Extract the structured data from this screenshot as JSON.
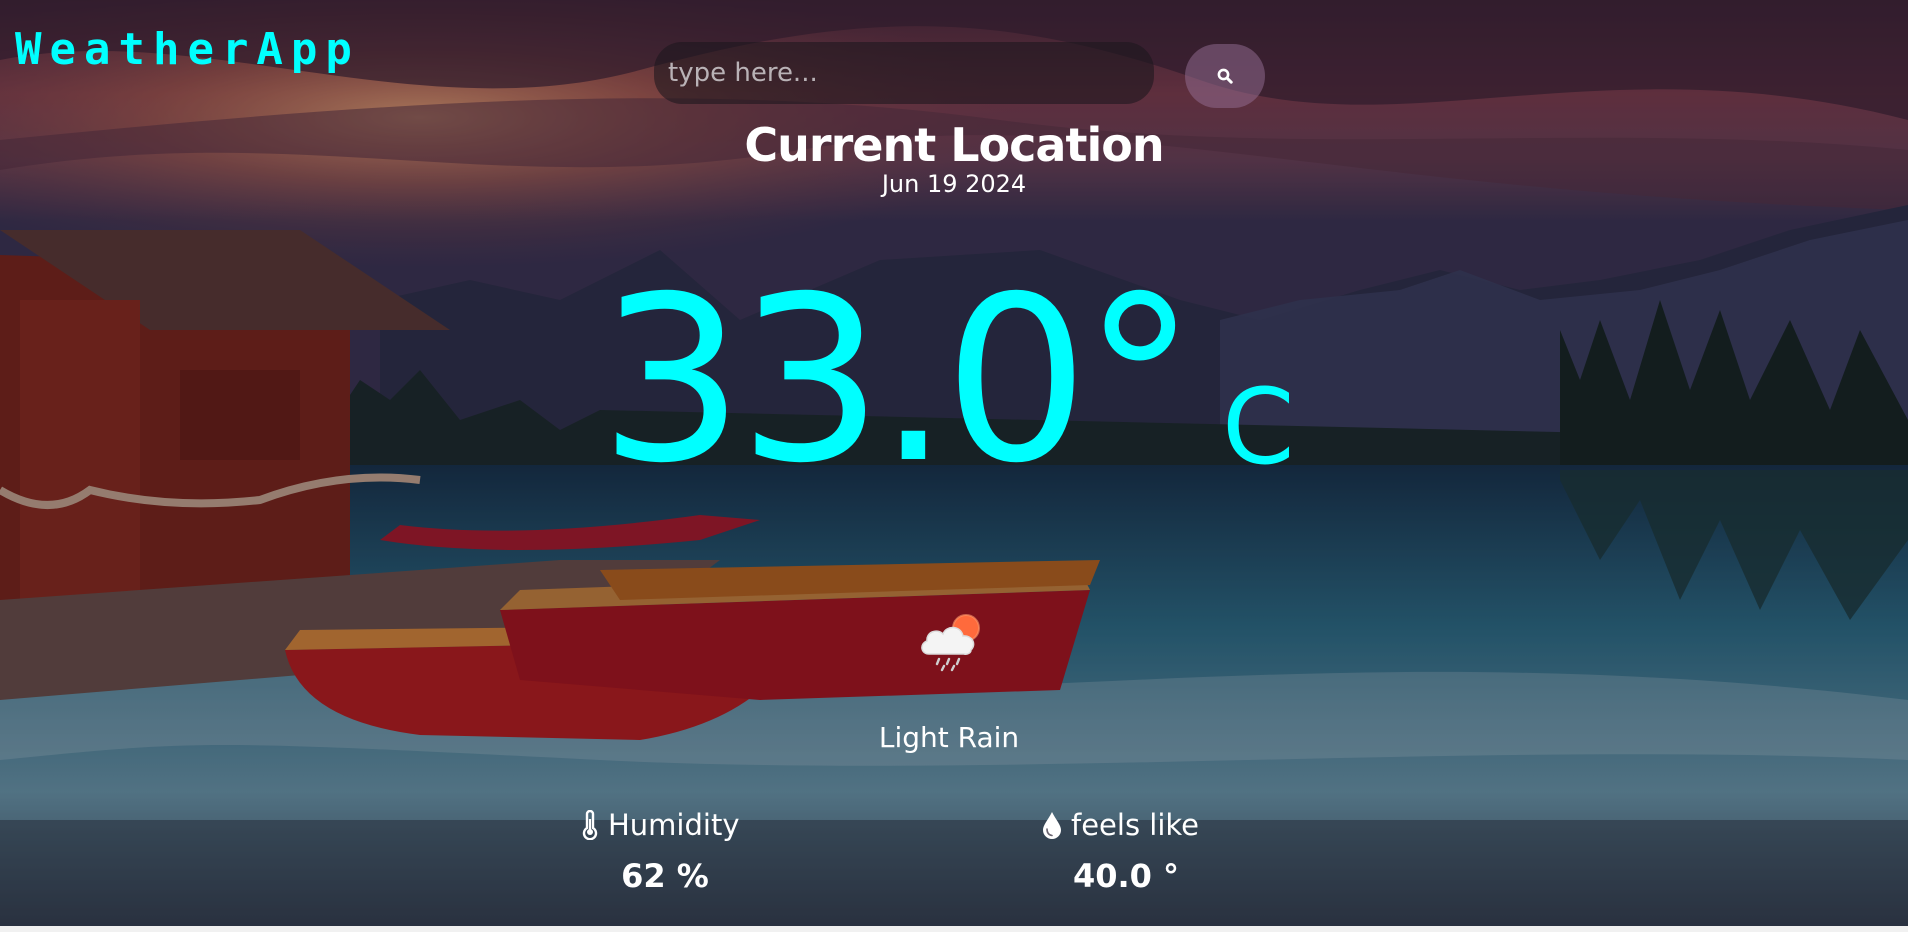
{
  "app": {
    "title": "WeatherApp"
  },
  "search": {
    "placeholder": "type here...",
    "icon": "search-icon"
  },
  "location": {
    "name": "Current Location",
    "date": "Jun 19 2024"
  },
  "current": {
    "temperature": "33.0°",
    "unit": "C",
    "condition": "Light Rain",
    "icon": "cloud-sun-rain-icon"
  },
  "stats": {
    "humidity": {
      "label": "Humidity",
      "value": "62 %",
      "icon": "thermometer-icon"
    },
    "feels_like": {
      "label": "feels like",
      "value": "40.0 °",
      "icon": "water-drop-icon"
    }
  },
  "colors": {
    "accent": "#00ffff",
    "text": "#ffffff"
  }
}
